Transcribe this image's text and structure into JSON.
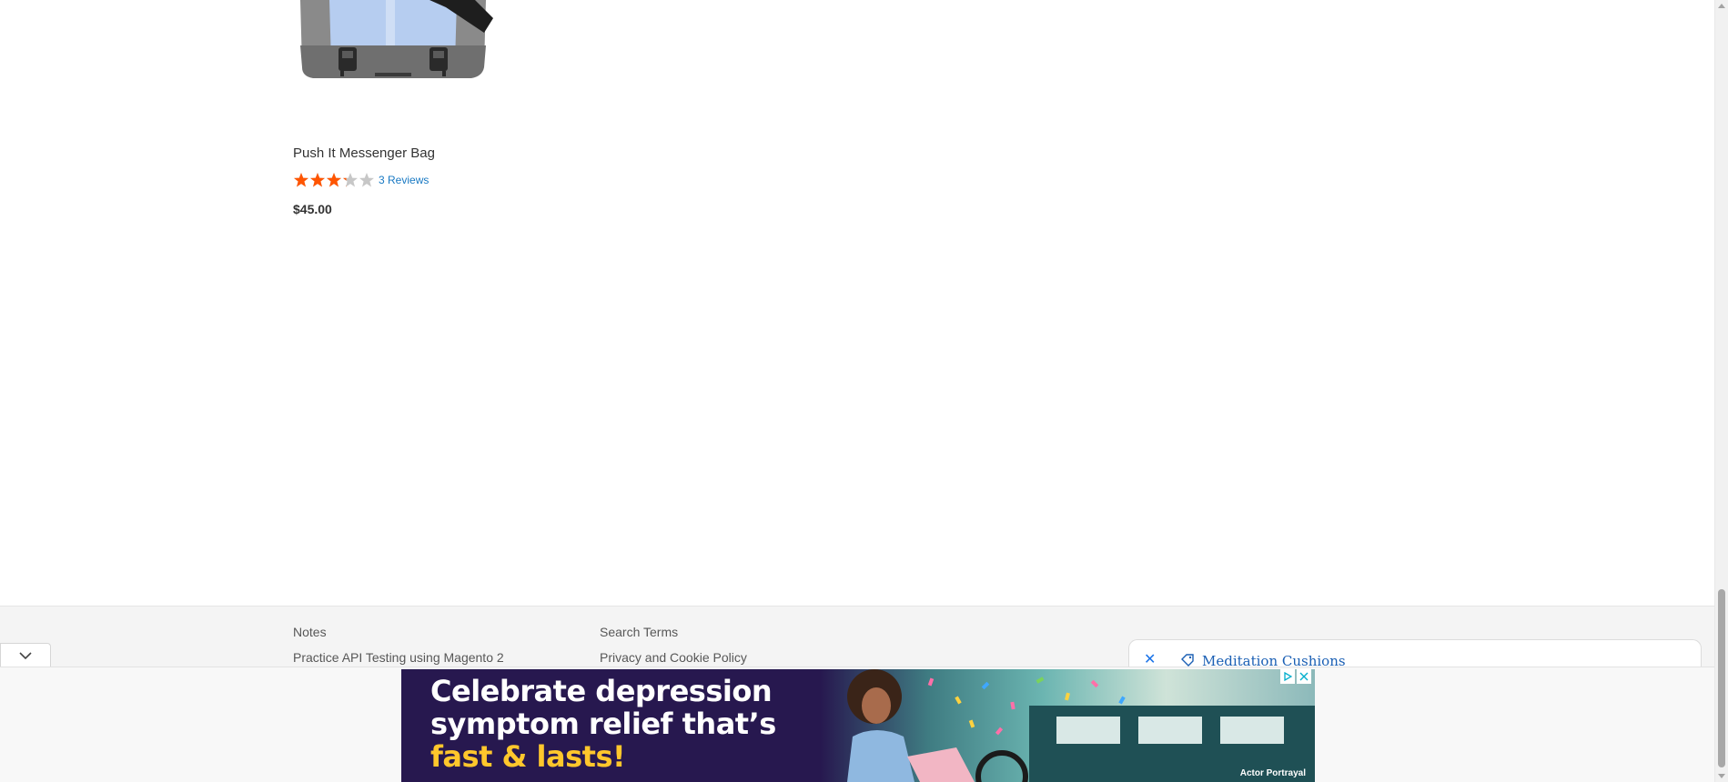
{
  "product": {
    "name": "Push It Messenger Bag",
    "rating_fraction": 0.65,
    "reviews_label": "3 Reviews",
    "price": "$45.00"
  },
  "footer": {
    "links": [
      {
        "label": "Notes"
      },
      {
        "label": "Practice API Testing using Magento 2"
      },
      {
        "label": "Search Terms"
      },
      {
        "label": "Privacy and Cookie Policy"
      }
    ]
  },
  "search_chip": {
    "text": "Meditation Cushions"
  },
  "ad": {
    "headline_line1": "Celebrate depression",
    "headline_line2": "symptom relief that’s",
    "headline_line3": "fast & lasts!",
    "portrayal": "Actor Portrayal"
  },
  "colors": {
    "link": "#1979c3",
    "star_filled": "#ff5501",
    "star_empty": "#c7c7c7",
    "footer_bg": "#f4f4f4",
    "ad_bg": "#27184f",
    "ad_highlight": "#ffc72c"
  }
}
